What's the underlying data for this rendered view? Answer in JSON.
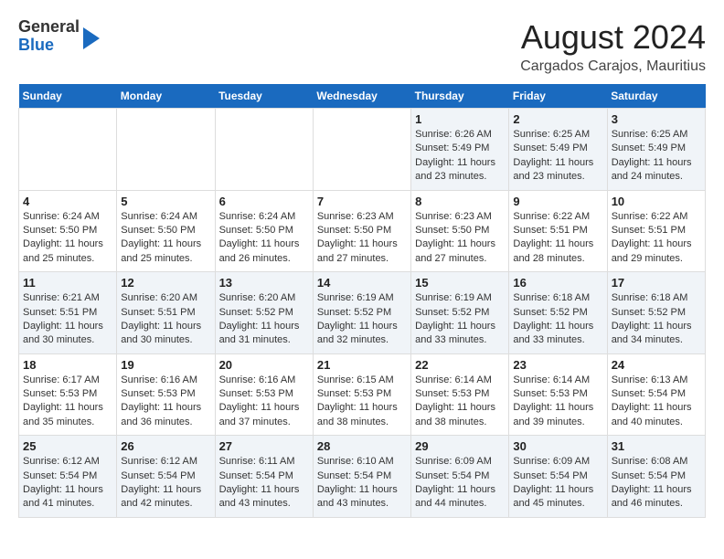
{
  "header": {
    "logo": {
      "line1": "General",
      "line2": "Blue"
    },
    "month_title": "August 2024",
    "location": "Cargados Carajos, Mauritius"
  },
  "days_of_week": [
    "Sunday",
    "Monday",
    "Tuesday",
    "Wednesday",
    "Thursday",
    "Friday",
    "Saturday"
  ],
  "weeks": [
    [
      {
        "day": "",
        "info": ""
      },
      {
        "day": "",
        "info": ""
      },
      {
        "day": "",
        "info": ""
      },
      {
        "day": "",
        "info": ""
      },
      {
        "day": "1",
        "info": "Sunrise: 6:26 AM\nSunset: 5:49 PM\nDaylight: 11 hours and 23 minutes."
      },
      {
        "day": "2",
        "info": "Sunrise: 6:25 AM\nSunset: 5:49 PM\nDaylight: 11 hours and 23 minutes."
      },
      {
        "day": "3",
        "info": "Sunrise: 6:25 AM\nSunset: 5:49 PM\nDaylight: 11 hours and 24 minutes."
      }
    ],
    [
      {
        "day": "4",
        "info": "Sunrise: 6:24 AM\nSunset: 5:50 PM\nDaylight: 11 hours and 25 minutes."
      },
      {
        "day": "5",
        "info": "Sunrise: 6:24 AM\nSunset: 5:50 PM\nDaylight: 11 hours and 25 minutes."
      },
      {
        "day": "6",
        "info": "Sunrise: 6:24 AM\nSunset: 5:50 PM\nDaylight: 11 hours and 26 minutes."
      },
      {
        "day": "7",
        "info": "Sunrise: 6:23 AM\nSunset: 5:50 PM\nDaylight: 11 hours and 27 minutes."
      },
      {
        "day": "8",
        "info": "Sunrise: 6:23 AM\nSunset: 5:50 PM\nDaylight: 11 hours and 27 minutes."
      },
      {
        "day": "9",
        "info": "Sunrise: 6:22 AM\nSunset: 5:51 PM\nDaylight: 11 hours and 28 minutes."
      },
      {
        "day": "10",
        "info": "Sunrise: 6:22 AM\nSunset: 5:51 PM\nDaylight: 11 hours and 29 minutes."
      }
    ],
    [
      {
        "day": "11",
        "info": "Sunrise: 6:21 AM\nSunset: 5:51 PM\nDaylight: 11 hours and 30 minutes."
      },
      {
        "day": "12",
        "info": "Sunrise: 6:20 AM\nSunset: 5:51 PM\nDaylight: 11 hours and 30 minutes."
      },
      {
        "day": "13",
        "info": "Sunrise: 6:20 AM\nSunset: 5:52 PM\nDaylight: 11 hours and 31 minutes."
      },
      {
        "day": "14",
        "info": "Sunrise: 6:19 AM\nSunset: 5:52 PM\nDaylight: 11 hours and 32 minutes."
      },
      {
        "day": "15",
        "info": "Sunrise: 6:19 AM\nSunset: 5:52 PM\nDaylight: 11 hours and 33 minutes."
      },
      {
        "day": "16",
        "info": "Sunrise: 6:18 AM\nSunset: 5:52 PM\nDaylight: 11 hours and 33 minutes."
      },
      {
        "day": "17",
        "info": "Sunrise: 6:18 AM\nSunset: 5:52 PM\nDaylight: 11 hours and 34 minutes."
      }
    ],
    [
      {
        "day": "18",
        "info": "Sunrise: 6:17 AM\nSunset: 5:53 PM\nDaylight: 11 hours and 35 minutes."
      },
      {
        "day": "19",
        "info": "Sunrise: 6:16 AM\nSunset: 5:53 PM\nDaylight: 11 hours and 36 minutes."
      },
      {
        "day": "20",
        "info": "Sunrise: 6:16 AM\nSunset: 5:53 PM\nDaylight: 11 hours and 37 minutes."
      },
      {
        "day": "21",
        "info": "Sunrise: 6:15 AM\nSunset: 5:53 PM\nDaylight: 11 hours and 38 minutes."
      },
      {
        "day": "22",
        "info": "Sunrise: 6:14 AM\nSunset: 5:53 PM\nDaylight: 11 hours and 38 minutes."
      },
      {
        "day": "23",
        "info": "Sunrise: 6:14 AM\nSunset: 5:53 PM\nDaylight: 11 hours and 39 minutes."
      },
      {
        "day": "24",
        "info": "Sunrise: 6:13 AM\nSunset: 5:54 PM\nDaylight: 11 hours and 40 minutes."
      }
    ],
    [
      {
        "day": "25",
        "info": "Sunrise: 6:12 AM\nSunset: 5:54 PM\nDaylight: 11 hours and 41 minutes."
      },
      {
        "day": "26",
        "info": "Sunrise: 6:12 AM\nSunset: 5:54 PM\nDaylight: 11 hours and 42 minutes."
      },
      {
        "day": "27",
        "info": "Sunrise: 6:11 AM\nSunset: 5:54 PM\nDaylight: 11 hours and 43 minutes."
      },
      {
        "day": "28",
        "info": "Sunrise: 6:10 AM\nSunset: 5:54 PM\nDaylight: 11 hours and 43 minutes."
      },
      {
        "day": "29",
        "info": "Sunrise: 6:09 AM\nSunset: 5:54 PM\nDaylight: 11 hours and 44 minutes."
      },
      {
        "day": "30",
        "info": "Sunrise: 6:09 AM\nSunset: 5:54 PM\nDaylight: 11 hours and 45 minutes."
      },
      {
        "day": "31",
        "info": "Sunrise: 6:08 AM\nSunset: 5:54 PM\nDaylight: 11 hours and 46 minutes."
      }
    ]
  ]
}
